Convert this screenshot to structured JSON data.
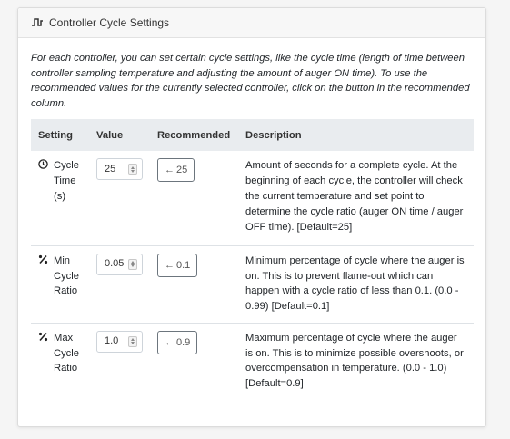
{
  "card": {
    "title": "Controller Cycle Settings",
    "icon": "pulse-wave-icon"
  },
  "intro": "For each controller, you can set certain cycle settings, like the cycle time (length of time between controller sampling temperature and adjusting the amount of auger ON time). To use the recommended values for the currently selected controller, click on the button in the recommended column.",
  "table": {
    "headers": [
      "Setting",
      "Value",
      "Recommended",
      "Description"
    ],
    "rows": [
      {
        "icon": "clock-icon",
        "setting": "Cycle Time (s)",
        "value": "25",
        "recommended": "25",
        "description": "Amount of seconds for a complete cycle. At the beginning of each cycle, the controller will check the current temperature and set point to determine the cycle ratio (auger ON time / auger OFF time). [Default=25]"
      },
      {
        "icon": "percent-icon",
        "setting": "Min Cycle Ratio",
        "value": "0.05",
        "recommended": "0.1",
        "description": "Minimum percentage of cycle where the auger is on. This is to prevent flame-out which can happen with a cycle ratio of less than 0.1. (0.0 - 0.99) [Default=0.1]"
      },
      {
        "icon": "percent-icon",
        "setting": "Max Cycle Ratio",
        "value": "1.0",
        "recommended": "0.9",
        "description": "Maximum percentage of cycle where the auger is on. This is to minimize possible overshoots, or overcompensation in temperature. (0.0 - 1.0) [Default=0.9]"
      }
    ]
  },
  "arrow_glyph": "←"
}
